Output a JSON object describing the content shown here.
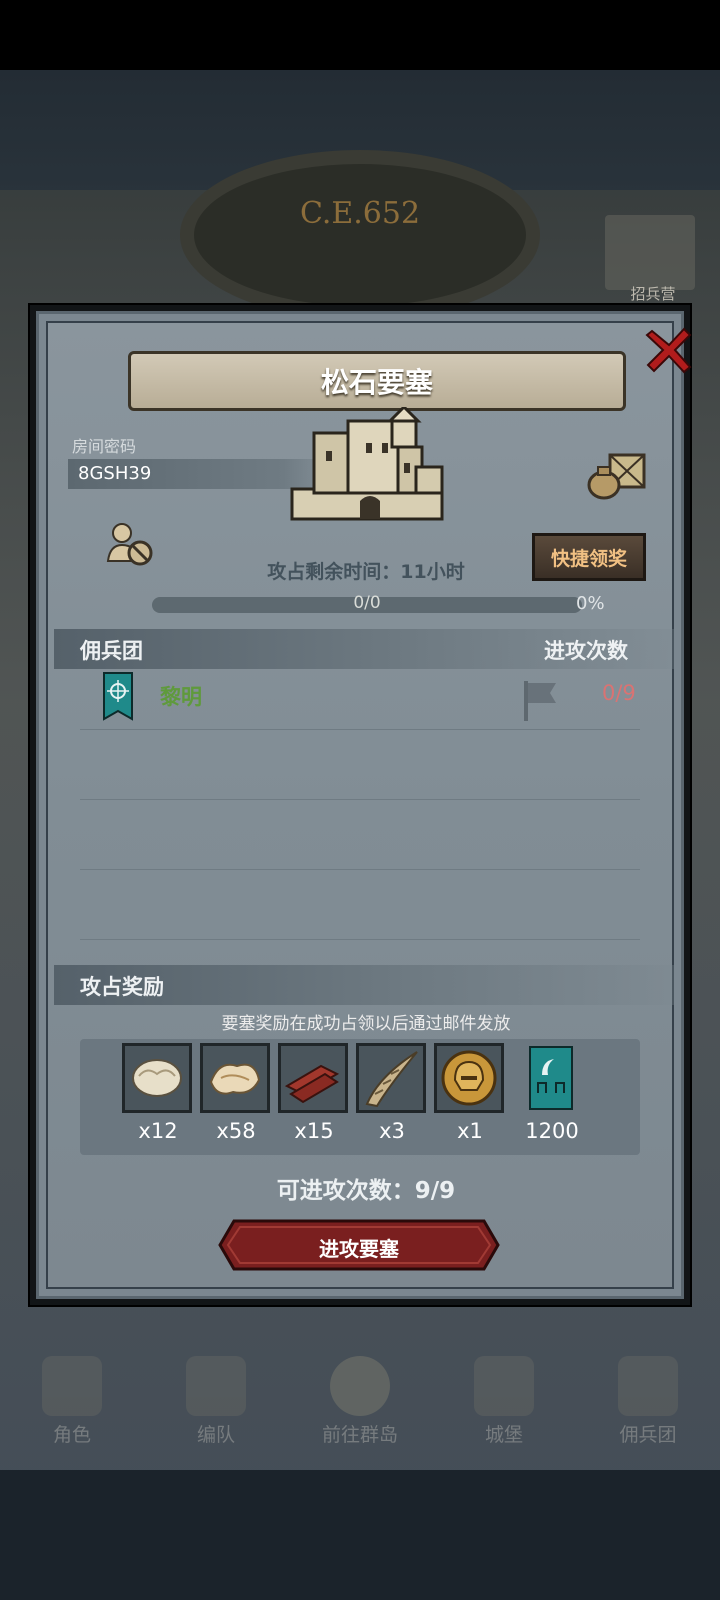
{
  "background": {
    "era_label": "C.E.652",
    "top_right_label": "招兵营",
    "nav": [
      {
        "label": "角色"
      },
      {
        "label": "编队"
      },
      {
        "label": "前往群岛"
      },
      {
        "label": "城堡"
      },
      {
        "label": "佣兵团"
      }
    ]
  },
  "modal": {
    "title": "松石要塞",
    "room": {
      "label": "房间密码",
      "code": "8GSH39"
    },
    "quick_claim_label": "快捷领奖",
    "remaining_time": "攻占剩余时间：11小时",
    "progress": {
      "text": "0/0",
      "percent_text": "0%",
      "fraction": 0
    },
    "section_mercenary": {
      "left": "佣兵团",
      "right": "进攻次数"
    },
    "guild_row": {
      "name": "黎明",
      "attacks": "0/9"
    },
    "section_reward": {
      "label": "攻占奖励"
    },
    "reward_note": "要塞奖励在成功占领以后通过邮件发放",
    "rewards": [
      {
        "icon": "fleece-icon",
        "qty": "x12"
      },
      {
        "icon": "fur-pelt-icon",
        "qty": "x58"
      },
      {
        "icon": "wood-planks-icon",
        "qty": "x15"
      },
      {
        "icon": "horn-icon",
        "qty": "x3"
      },
      {
        "icon": "golden-helmet-icon",
        "qty": "x1"
      },
      {
        "icon": "guild-banner-icon",
        "qty": "1200"
      }
    ],
    "attacks_available": "可进攻次数：9/9",
    "attack_button_label": "进攻要塞"
  },
  "colors": {
    "guild_name": "#5f9a3c",
    "attack_count": "#d97373",
    "button_red": "#7a1f1f",
    "quick_claim_text": "#f1c083"
  }
}
